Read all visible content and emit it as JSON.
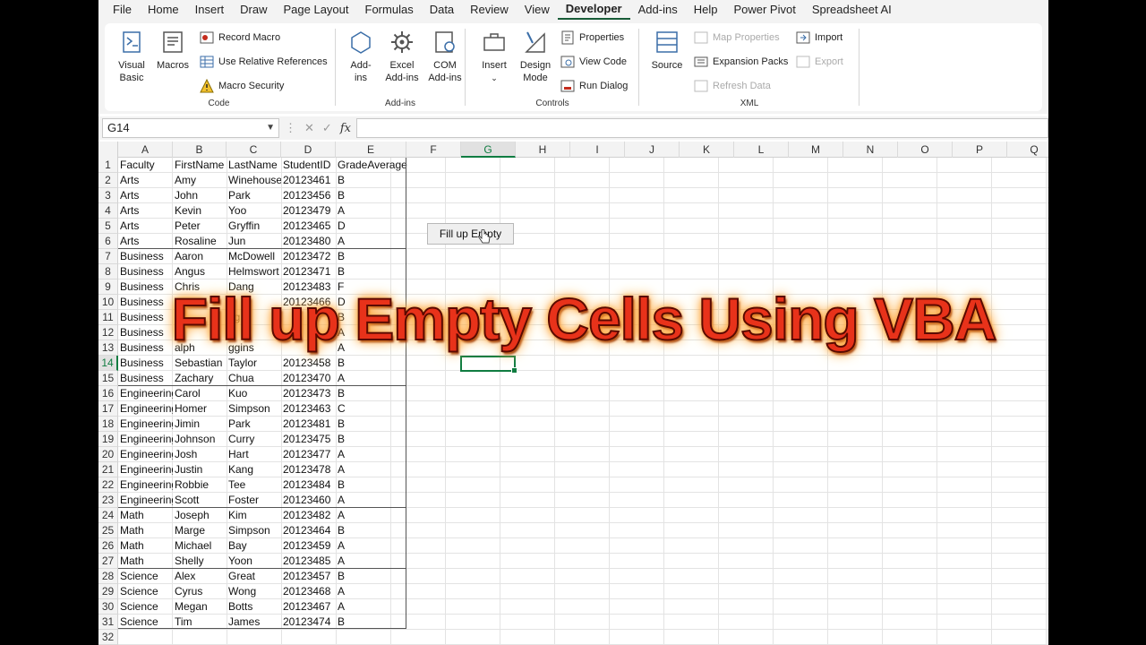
{
  "menu": {
    "tabs": [
      "File",
      "Home",
      "Insert",
      "Draw",
      "Page Layout",
      "Formulas",
      "Data",
      "Review",
      "View",
      "Developer",
      "Add-ins",
      "Help",
      "Power Pivot",
      "Spreadsheet AI"
    ],
    "active_tab": "Developer"
  },
  "ribbon": {
    "code": {
      "label": "Code",
      "visual_basic": "Visual Basic",
      "macros": "Macros",
      "record_macro": "Record Macro",
      "use_relative": "Use Relative References",
      "macro_security": "Macro Security"
    },
    "addins": {
      "label": "Add-ins",
      "addins": "Add-ins",
      "excel_addins": "Excel Add-ins",
      "com_addins": "COM Add-ins"
    },
    "controls": {
      "label": "Controls",
      "insert": "Insert",
      "design_mode": "Design Mode",
      "properties": "Properties",
      "view_code": "View Code",
      "run_dialog": "Run Dialog"
    },
    "xml": {
      "label": "XML",
      "source": "Source",
      "map_properties": "Map Properties",
      "expansion_packs": "Expansion Packs",
      "refresh_data": "Refresh Data",
      "import": "Import",
      "export": "Export"
    }
  },
  "formula_bar": {
    "name_box": "G14",
    "fx": "fx",
    "formula": ""
  },
  "columns": [
    "A",
    "B",
    "C",
    "D",
    "E",
    "F",
    "G",
    "H",
    "I",
    "J",
    "K",
    "L",
    "M",
    "N",
    "O",
    "P",
    "Q"
  ],
  "selected_column": "G",
  "selected_row": "14",
  "rows": [
    "1",
    "2",
    "3",
    "4",
    "5",
    "6",
    "7",
    "8",
    "9",
    "10",
    "11",
    "12",
    "13",
    "14",
    "15",
    "16",
    "17",
    "18",
    "19",
    "20",
    "21",
    "22",
    "23",
    "24",
    "25",
    "26",
    "27",
    "28",
    "29",
    "30",
    "31",
    "32"
  ],
  "table": [
    [
      "Faculty",
      "FirstName",
      "LastName",
      "StudentID",
      "GradeAverage"
    ],
    [
      "Arts",
      "Amy",
      "Winehouse",
      "20123461",
      "B"
    ],
    [
      "Arts",
      "John",
      "Park",
      "20123456",
      "B"
    ],
    [
      "Arts",
      "Kevin",
      "Yoo",
      "20123479",
      "A"
    ],
    [
      "Arts",
      "Peter",
      "Gryffin",
      "20123465",
      "D"
    ],
    [
      "Arts",
      "Rosaline",
      "Jun",
      "20123480",
      "A"
    ],
    [
      "Business",
      "Aaron",
      "McDowell",
      "20123472",
      "B"
    ],
    [
      "Business",
      "Angus",
      "Helmswort",
      "20123471",
      "B"
    ],
    [
      "Business",
      "Chris",
      "Dang",
      "20123483",
      "F"
    ],
    [
      "Business",
      "",
      "",
      "20123466",
      "D"
    ],
    [
      "Business",
      "",
      "ng",
      "",
      "B"
    ],
    [
      "Business",
      "",
      "d",
      "",
      "A"
    ],
    [
      "Business",
      "alph",
      "ggins",
      "",
      "A"
    ],
    [
      "Business",
      "Sebastian",
      "Taylor",
      "20123458",
      "B"
    ],
    [
      "Business",
      "Zachary",
      "Chua",
      "20123470",
      "A"
    ],
    [
      "Engineering",
      "Carol",
      "Kuo",
      "20123473",
      "B"
    ],
    [
      "Engineering",
      "Homer",
      "Simpson",
      "20123463",
      "C"
    ],
    [
      "Engineering",
      "Jimin",
      "Park",
      "20123481",
      "B"
    ],
    [
      "Engineering",
      "Johnson",
      "Curry",
      "20123475",
      "B"
    ],
    [
      "Engineering",
      "Josh",
      "Hart",
      "20123477",
      "A"
    ],
    [
      "Engineering",
      "Justin",
      "Kang",
      "20123478",
      "A"
    ],
    [
      "Engineering",
      "Robbie",
      "Tee",
      "20123484",
      "B"
    ],
    [
      "Engineering",
      "Scott",
      "Foster",
      "20123460",
      "A"
    ],
    [
      "Math",
      "Joseph",
      "Kim",
      "20123482",
      "A"
    ],
    [
      "Math",
      "Marge",
      "Simpson",
      "20123464",
      "B"
    ],
    [
      "Math",
      "Michael",
      "Bay",
      "20123459",
      "A"
    ],
    [
      "Math",
      "Shelly",
      "Yoon",
      "20123485",
      "A"
    ],
    [
      "Science",
      "Alex",
      "Great",
      "20123457",
      "B"
    ],
    [
      "Science",
      "Cyrus",
      "Wong",
      "20123468",
      "A"
    ],
    [
      "Science",
      "Megan",
      "Botts",
      "20123467",
      "A"
    ],
    [
      "Science",
      "Tim",
      "James",
      "20123474",
      "B"
    ]
  ],
  "fill_button": "Fill up Empty",
  "overlay_title": "Fill up Empty Cells Using VBA",
  "colors": {
    "accent": "#107c41",
    "title": "#e8321a"
  }
}
